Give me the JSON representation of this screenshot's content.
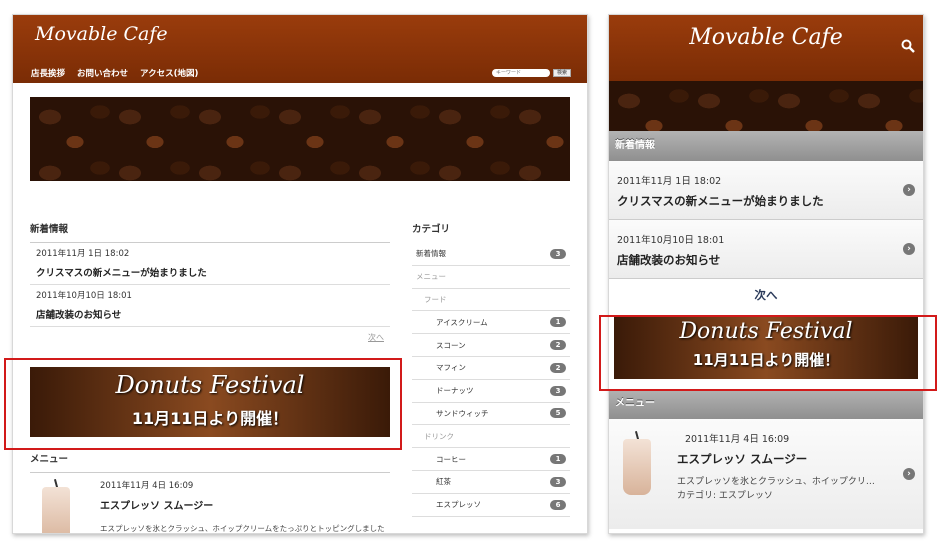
{
  "site": {
    "logo": "Movable Cafe"
  },
  "desktop": {
    "nav": [
      "店長挨拶",
      "お問い合わせ",
      "アクセス(地図)"
    ],
    "search": {
      "placeholder": "キーワード",
      "button": "検索"
    },
    "news": {
      "title": "新着情報",
      "items": [
        {
          "date": "2011年11月 1日 18:02",
          "title": "クリスマスの新メニューが始まりました"
        },
        {
          "date": "2011年10月10日 18:01",
          "title": "店舗改装のお知らせ"
        }
      ],
      "next": "次へ"
    },
    "ad": {
      "title": "Donuts Festival",
      "subtitle": "11月11日より開催！"
    },
    "menu": {
      "title": "メニュー",
      "item": {
        "date": "2011年11月 4日 16:09",
        "name": "エスプレッソ スムージー",
        "desc": "エスプレッソを氷とクラッシュ、ホイップクリームをたっぷりとトッピングしました"
      }
    },
    "categories": {
      "title": "カテゴリ",
      "items": [
        {
          "label": "新着情報",
          "count": "3",
          "level": 1
        },
        {
          "label": "メニュー",
          "count": "",
          "level": 1
        },
        {
          "label": "フード",
          "count": "",
          "level": 2
        },
        {
          "label": "アイスクリーム",
          "count": "1",
          "level": 3
        },
        {
          "label": "スコーン",
          "count": "2",
          "level": 3
        },
        {
          "label": "マフィン",
          "count": "2",
          "level": 3
        },
        {
          "label": "ドーナッツ",
          "count": "3",
          "level": 3
        },
        {
          "label": "サンドウィッチ",
          "count": "5",
          "level": 3
        },
        {
          "label": "ドリンク",
          "count": "",
          "level": 2
        },
        {
          "label": "コーヒー",
          "count": "1",
          "level": 3
        },
        {
          "label": "紅茶",
          "count": "3",
          "level": 3
        },
        {
          "label": "エスプレッソ",
          "count": "6",
          "level": 3
        }
      ]
    }
  },
  "mobile": {
    "news_title": "新着情報",
    "items": [
      {
        "date": "2011年11月 1日 18:02",
        "title": "クリスマスの新メニューが始まりました"
      },
      {
        "date": "2011年10月10日 18:01",
        "title": "店舗改装のお知らせ"
      }
    ],
    "next": "次へ",
    "ad": {
      "title": "Donuts Festival",
      "subtitle": "11月11日より開催！"
    },
    "menu_title": "メニュー",
    "menu_item": {
      "date": "2011年11月 4日 16:09",
      "name": "エスプレッソ スムージー",
      "desc": "エスプレッソを氷とクラッシュ、ホイップクリ…",
      "category": "カテゴリ: エスプレッソ"
    }
  },
  "colors": {
    "header": "#8a3408",
    "highlight": "#d21a1a",
    "badge": "#777777"
  }
}
